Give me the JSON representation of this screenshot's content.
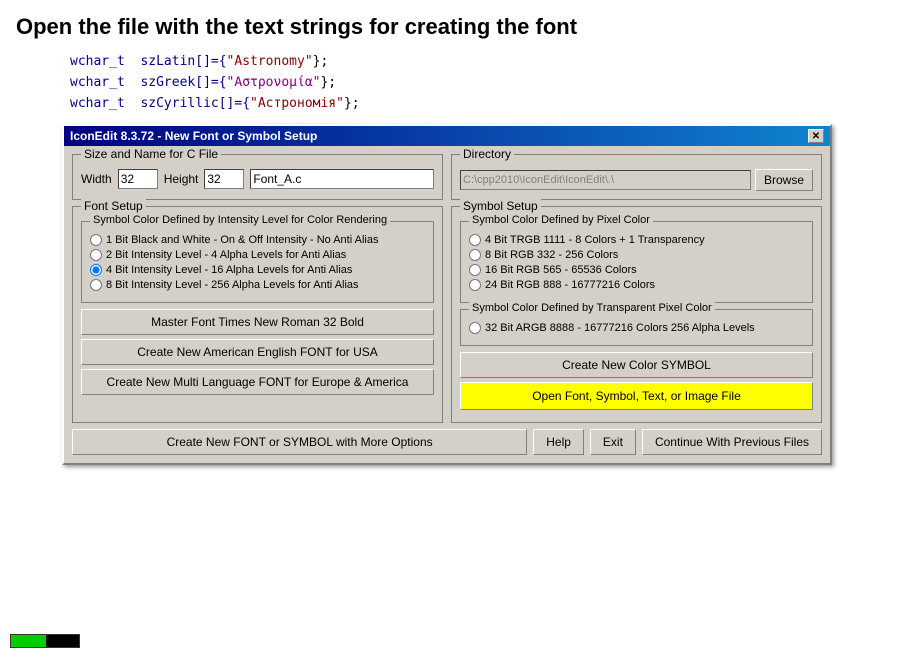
{
  "header": {
    "title": "Open the file with the text strings for creating the font"
  },
  "code": {
    "line1_keyword": "wchar_t",
    "line1_var": "szLatin",
    "line1_value": "\"Astronomy\"",
    "line2_keyword": "wchar_t",
    "line2_var": "szGreek",
    "line2_value": "\"Αστρονομία\"",
    "line3_keyword": "wchar_t",
    "line3_var": "szCyrillic",
    "line3_value": "\"Астрономiя\""
  },
  "dialog": {
    "title": "IconEdit 8.3.72 - New Font or Symbol Setup",
    "close_btn": "✕",
    "size_name_group_label": "Size and Name for C File",
    "width_label": "Width",
    "height_label": "Height",
    "width_value": "32",
    "height_value": "32",
    "filename_value": "Font_A.c",
    "directory_group_label": "Directory",
    "directory_value": "C:\\cpp2010\\IconEdit\\IconEdit\\.\\ ",
    "browse_label": "Browse",
    "font_setup_group_label": "Font Setup",
    "intensity_group_label": "Symbol Color Defined by Intensity Level for Color Rendering",
    "radio1_label": "1 Bit Black and White - On & Off Intensity - No Anti Alias",
    "radio2_label": "2 Bit Intensity Level - 4 Alpha Levels for Anti Alias",
    "radio3_label": "4 Bit Intensity Level - 16 Alpha Levels for Anti Alias",
    "radio4_label": "8 Bit Intensity Level - 256 Alpha Levels for Anti Alias",
    "radio3_checked": true,
    "master_font_btn": "Master Font  Times New Roman 32 Bold",
    "create_american_btn": "Create New American English FONT for USA",
    "create_multilang_btn": "Create New Multi Language FONT for Europe & America",
    "symbol_setup_group_label": "Symbol Setup",
    "pixel_color_group_label": "Symbol Color Defined by Pixel Color",
    "pixel_radio1_label": "4 Bit TRGB 1111 - 8 Colors + 1 Transparency",
    "pixel_radio2_label": "8 Bit RGB 332 - 256 Colors",
    "pixel_radio3_label": "16 Bit RGB 565 - 65536 Colors",
    "pixel_radio4_label": "24 Bit RGB 888 - 16777216 Colors",
    "transparent_group_label": "Symbol Color Defined by Transparent Pixel Color",
    "transparent_radio1_label": "32 Bit ARGB 8888 - 16777216 Colors 256 Alpha Levels",
    "create_symbol_btn": "Create New Color SYMBOL",
    "open_file_btn": "Open Font, Symbol, Text, or Image File",
    "create_more_btn": "Create New FONT or SYMBOL with More Options",
    "help_btn": "Help",
    "exit_btn": "Exit",
    "continue_btn": "Continue With Previous Files"
  }
}
